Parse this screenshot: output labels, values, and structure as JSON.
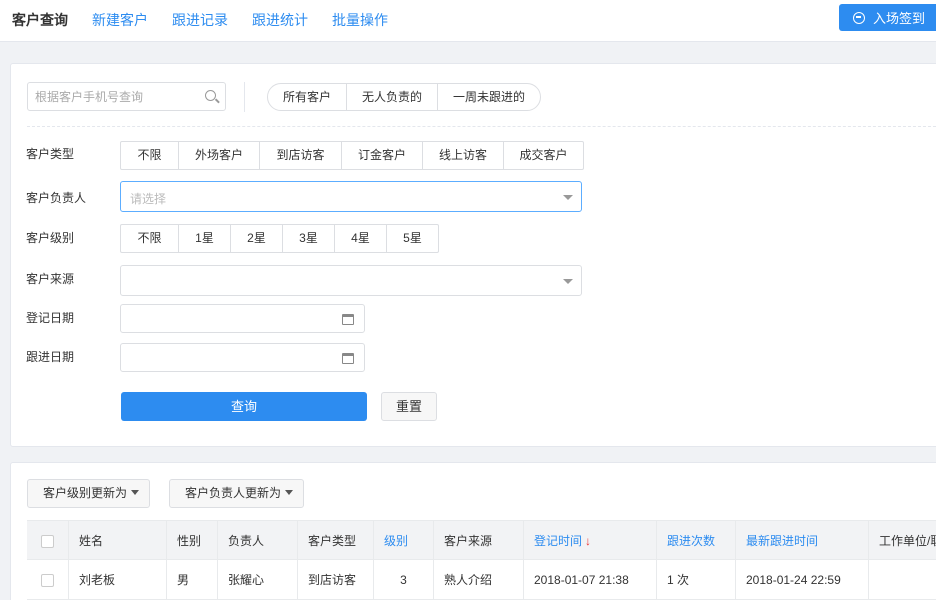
{
  "topnav": {
    "items": [
      {
        "label": "客户查询",
        "active": true
      },
      {
        "label": "新建客户",
        "active": false
      },
      {
        "label": "跟进记录",
        "active": false
      },
      {
        "label": "跟进统计",
        "active": false
      },
      {
        "label": "批量操作",
        "active": false
      }
    ],
    "checkin_label": "入场签到"
  },
  "filter": {
    "search_placeholder": "根据客户手机号查询",
    "quick": [
      "所有客户",
      "无人负责的",
      "一周未跟进的"
    ],
    "customer_type": {
      "label": "客户类型",
      "options": [
        "不限",
        "外场客户",
        "到店访客",
        "订金客户",
        "线上访客",
        "成交客户"
      ]
    },
    "owner": {
      "label": "客户负责人",
      "placeholder": "请选择"
    },
    "level": {
      "label": "客户级别",
      "options": [
        "不限",
        "1星",
        "2星",
        "3星",
        "4星",
        "5星"
      ]
    },
    "source": {
      "label": "客户来源",
      "value": ""
    },
    "register_date": {
      "label": "登记日期",
      "value": ""
    },
    "followup_date": {
      "label": "跟进日期",
      "value": ""
    },
    "query_label": "查询",
    "reset_label": "重置"
  },
  "table": {
    "bulk_actions": [
      "客户级别更新为",
      "客户负责人更新为"
    ],
    "columns": [
      "姓名",
      "性别",
      "负责人",
      "客户类型",
      "级别",
      "客户来源",
      "登记时间",
      "跟进次数",
      "最新跟进时间",
      "工作单位/职"
    ],
    "sort_arrow": "↓",
    "rows": [
      {
        "name": "刘老板",
        "gender": "男",
        "owner": "张耀心",
        "type": "到店访客",
        "level": "3",
        "source": "熟人介绍",
        "registered": "2018-01-07 21:38",
        "followups": "1 次",
        "last_followup": "2018-01-24 22:59",
        "company": ""
      }
    ]
  },
  "colors": {
    "accent": "#2d8cf0",
    "status_green": "#19be6b",
    "sort_red": "#ee3333"
  }
}
